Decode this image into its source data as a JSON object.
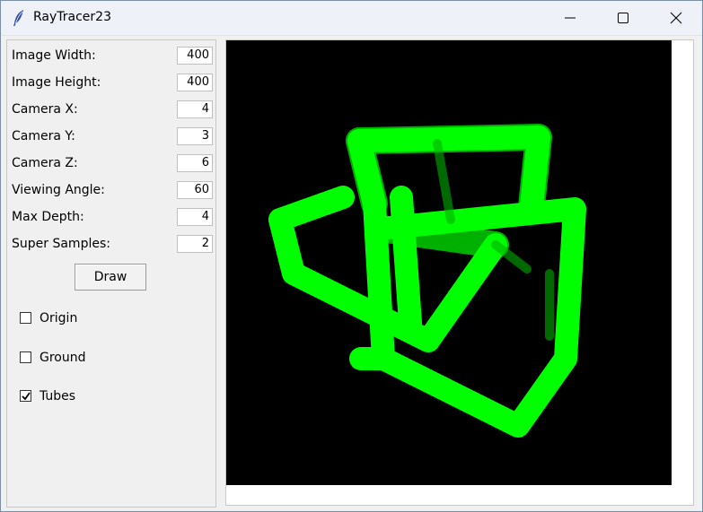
{
  "window": {
    "title": "RayTracer23"
  },
  "icons": {
    "app": "feather-icon",
    "minimize": "minimize-icon",
    "maximize": "maximize-icon",
    "close": "close-icon",
    "checkmark": "checkmark-icon"
  },
  "fields": [
    {
      "label": "Image Width:",
      "value": "400"
    },
    {
      "label": "Image Height:",
      "value": "400"
    },
    {
      "label": "Camera X:",
      "value": "4"
    },
    {
      "label": "Camera Y:",
      "value": "3"
    },
    {
      "label": "Camera Z:",
      "value": "6"
    },
    {
      "label": "Viewing Angle:",
      "value": "60"
    },
    {
      "label": "Max Depth:",
      "value": "4"
    },
    {
      "label": "Super Samples:",
      "value": "2"
    }
  ],
  "draw_button": {
    "label": "Draw"
  },
  "options": [
    {
      "label": "Origin",
      "checked": false
    },
    {
      "label": "Ground",
      "checked": false
    },
    {
      "label": "Tubes",
      "checked": true
    }
  ],
  "render": {
    "background_color": "#000000",
    "tube_color": "#00ff00",
    "tube_shadow_color": "#00b000"
  }
}
